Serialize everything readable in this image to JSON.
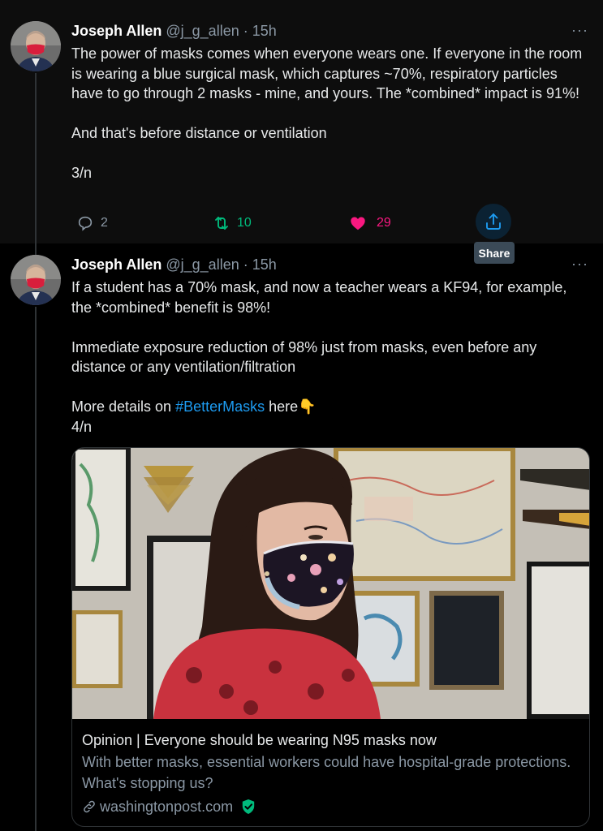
{
  "tweets": [
    {
      "author": {
        "name": "Joseph Allen",
        "handle": "@j_g_allen",
        "separator": "·",
        "time": "15h"
      },
      "more": "···",
      "text": [
        "The power of masks comes when everyone wears one. If everyone in the room is wearing a blue surgical mask, which captures ~70%, respiratory particles have to go through 2 masks - mine, and yours. The *combined* impact is 91%!",
        "",
        "And that's before distance or ventilation",
        "",
        "3/n"
      ],
      "actions": {
        "replies": "2",
        "retweets": "10",
        "likes": "29"
      },
      "liked": true
    },
    {
      "author": {
        "name": "Joseph Allen",
        "handle": "@j_g_allen",
        "separator": "·",
        "time": "15h"
      },
      "more": "···",
      "text_line1": "If a student has a 70% mask, and now a teacher wears a KF94, for example, the *combined* benefit is 98%!",
      "text_line2": "Immediate exposure reduction of 98% just from masks, even before any distance or any ventilation/filtration",
      "text_prefix": "More details on ",
      "hashtag": "#BetterMasks",
      "text_suffix": " here👇",
      "text_thread": "4/n",
      "card": {
        "title": "Opinion | Everyone should be wearing N95 masks now",
        "description": "With better masks, essential workers could have hospital-grade protections. What's stopping us?",
        "domain": "washingtonpost.com"
      }
    }
  ],
  "tooltip": {
    "share": "Share"
  },
  "icons": {
    "reply": "reply-icon",
    "retweet": "retweet-icon",
    "like": "heart-icon",
    "share": "share-icon",
    "more": "more-icon",
    "link": "link-icon",
    "verified": "verified-shield-icon"
  },
  "colors": {
    "background": "#000000",
    "text": "#e7e9ea",
    "muted": "#8b98a5",
    "accent": "#1d9bf0",
    "retweet": "#00ba7c",
    "like": "#f91880",
    "verified": "#00ba7c"
  }
}
